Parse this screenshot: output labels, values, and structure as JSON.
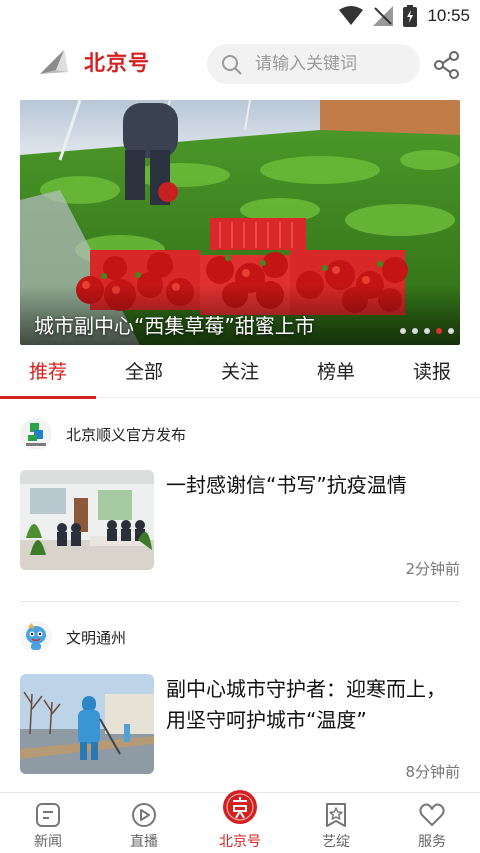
{
  "status_bar": {
    "time": "10:55"
  },
  "header": {
    "brand_title": "北京号",
    "search_placeholder": "请输入关键词"
  },
  "banner": {
    "caption": "城市副中心“西集草莓”甜蜜上市",
    "dots_total": 5,
    "active_dot": 4
  },
  "tabs": [
    {
      "label": "推荐",
      "active": true
    },
    {
      "label": "全部",
      "active": false
    },
    {
      "label": "关注",
      "active": false
    },
    {
      "label": "榜单",
      "active": false
    },
    {
      "label": "读报",
      "active": false
    }
  ],
  "articles": [
    {
      "source": "北京顺义官方发布",
      "title": "一封感谢信“书写”抗疫温情",
      "time": "2分钟前"
    },
    {
      "source": "文明通州",
      "title": "副中心城市守护者：迎寒而上，用坚守呵护城市“温度”",
      "time": "8分钟前"
    }
  ],
  "bottom_nav": [
    {
      "label": "新闻",
      "icon": "news-icon",
      "active": false
    },
    {
      "label": "直播",
      "icon": "live-play-icon",
      "active": false
    },
    {
      "label": "北京号",
      "icon": "beijing-hao-icon",
      "active": true
    },
    {
      "label": "艺绽",
      "icon": "yizhan-badge-icon",
      "active": false
    },
    {
      "label": "服务",
      "icon": "heart-icon",
      "active": false
    }
  ],
  "colors": {
    "accent": "#d61f1f",
    "dot_active": "#e0322c"
  }
}
